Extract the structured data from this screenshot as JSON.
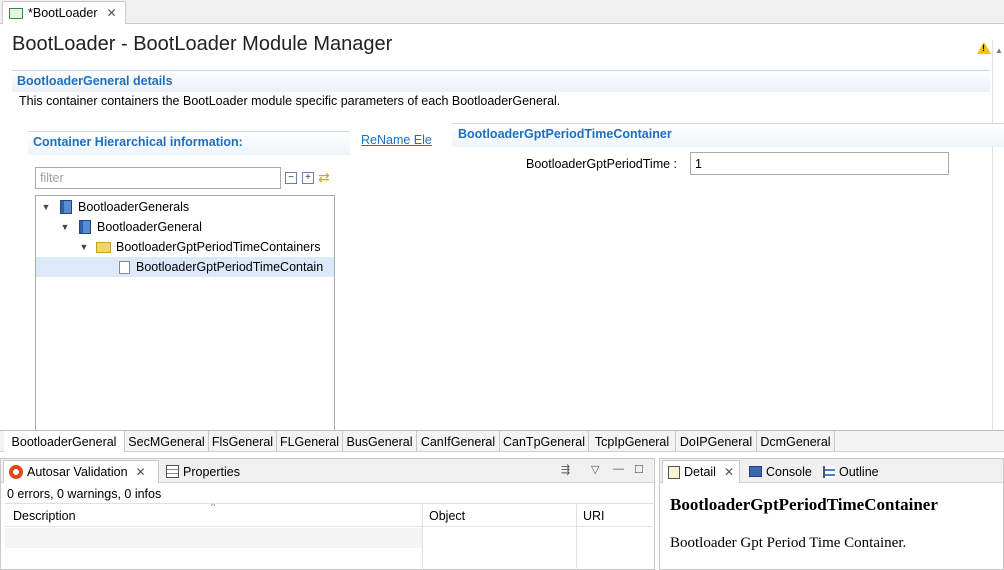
{
  "editor_tab": {
    "label": "*BootLoader",
    "close": "✕"
  },
  "header": {
    "title": "BootLoader - BootLoader Module Manager",
    "section_title": "BootloaderGeneral details",
    "section_desc": "This container containers the BootLoader module specific parameters of each BootloaderGeneral."
  },
  "hierarchy": {
    "title": "Container Hierarchical information:",
    "rename_link": "ReName Ele",
    "filter_placeholder": "filter",
    "tree": [
      {
        "label": "BootloaderGenerals",
        "expanded": true,
        "icon": "book-icon"
      },
      {
        "label": "BootloaderGeneral",
        "expanded": true,
        "icon": "book-icon"
      },
      {
        "label": "BootloaderGptPeriodTimeContainers",
        "expanded": true,
        "icon": "folder-icon"
      },
      {
        "label": "BootloaderGptPeriodTimeContain",
        "selected": true,
        "icon": "doc-icon"
      }
    ]
  },
  "details": {
    "title": "BootloaderGptPeriodTimeContainer",
    "field_label": "BootloaderGptPeriodTime :",
    "field_value": "1"
  },
  "page_tabs": [
    "BootloaderGeneral",
    "SecMGeneral",
    "FlsGeneral",
    "FLGeneral",
    "BusGeneral",
    "CanIfGeneral",
    "CanTpGeneral",
    "TcpIpGeneral",
    "DoIPGeneral",
    "DcmGeneral"
  ],
  "validation_view": {
    "tab_validation": "Autosar Validation",
    "tab_properties": "Properties",
    "status": "0 errors, 0 warnings, 0 infos",
    "columns": [
      "Description",
      "Object",
      "URI"
    ]
  },
  "detail_view": {
    "tab_detail": "Detail",
    "tab_console": "Console",
    "tab_outline": "Outline",
    "heading": "BootloaderGptPeriodTimeContainer",
    "description": "Bootloader Gpt Period Time Container."
  },
  "colors": {
    "accent_blue": "#1f6fbf",
    "selection": "#dce9f8"
  }
}
